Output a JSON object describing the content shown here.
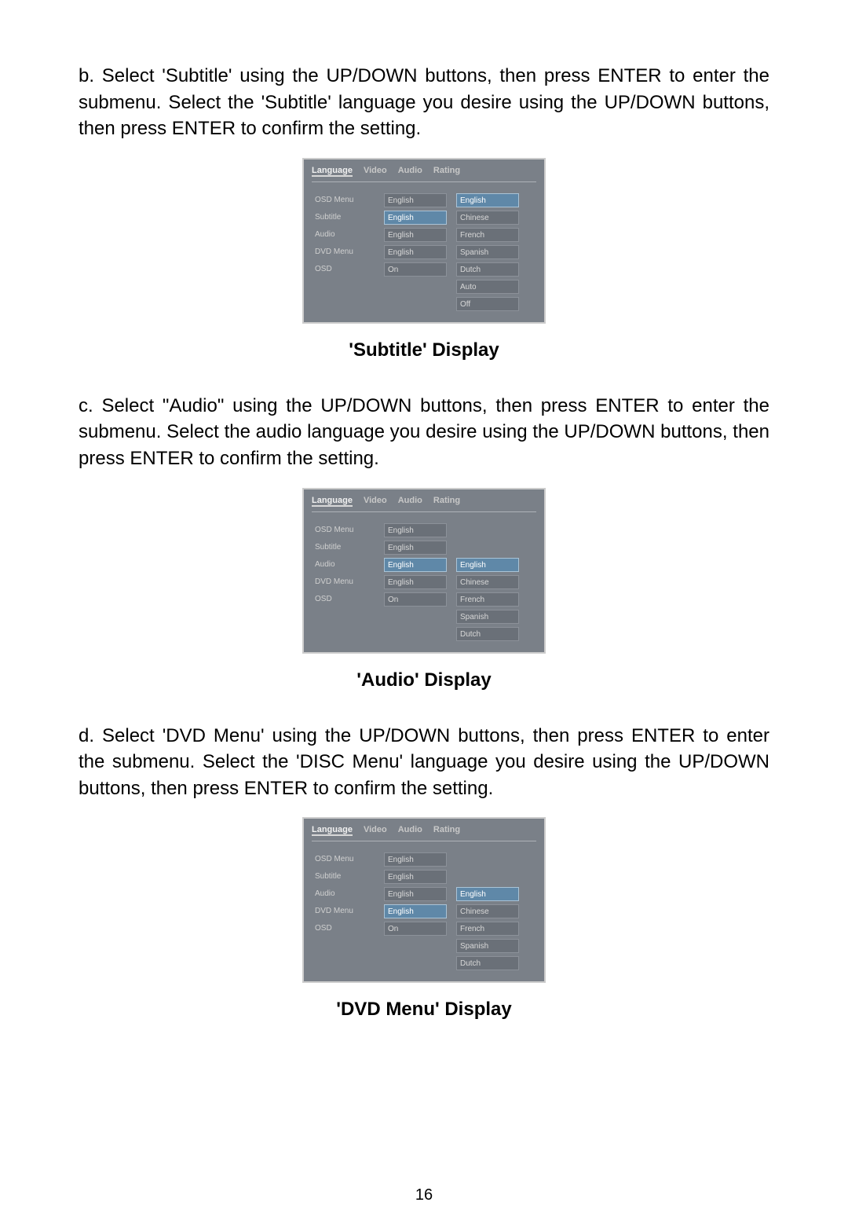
{
  "page_number": "16",
  "steps": {
    "b": {
      "letter": "b.",
      "text": "Select 'Subtitle' using  the UP/DOWN buttons, then press  ENTER to enter the submenu. Select  the 'Subtitle' language you desire using  the UP/DOWN buttons, then press ENTER to confirm the setting.",
      "caption": "'Subtitle' Display"
    },
    "c": {
      "letter": "c.",
      "text": "Select \"Audio\" using  the UP/DOWN buttons, then press  ENTER to enter the submenu. Select  the audio language you desire using the UP/DOWN buttons, then press ENTER to confirm the setting.",
      "caption": "'Audio' Display"
    },
    "d": {
      "letter": "d.",
      "text": "Select 'DVD Menu' using the UP/DOWN buttons, then press  ENTER to enter the submenu. Select  the 'DISC Menu' language you desire using  the UP/DOWN buttons, then press ENTER to confirm the setting.",
      "caption": "'DVD Menu' Display"
    }
  },
  "osd_common": {
    "tabs": [
      "Language",
      "Video",
      "Audio",
      "Rating"
    ],
    "left_items": [
      "OSD Menu",
      "Subtitle",
      "Audio",
      "DVD Menu",
      "OSD"
    ],
    "mid_values": [
      "English",
      "English",
      "English",
      "English",
      "On"
    ]
  },
  "osd_b": {
    "highlight_left_index": 1,
    "mid_highlight_index": 1,
    "right_items": [
      "English",
      "Chinese",
      "French",
      "Spanish",
      "Dutch",
      "Auto",
      "Off"
    ],
    "right_highlight_index": 0,
    "right_start_row": 0
  },
  "osd_c": {
    "highlight_left_index": 2,
    "mid_highlight_index": 2,
    "right_items": [
      "English",
      "Chinese",
      "French",
      "Spanish",
      "Dutch"
    ],
    "right_highlight_index": 0,
    "right_start_row": 2
  },
  "osd_d": {
    "highlight_left_index": 3,
    "mid_highlight_index": 3,
    "right_items": [
      "English",
      "Chinese",
      "French",
      "Spanish",
      "Dutch"
    ],
    "right_highlight_index": 0,
    "right_start_row": 2
  }
}
